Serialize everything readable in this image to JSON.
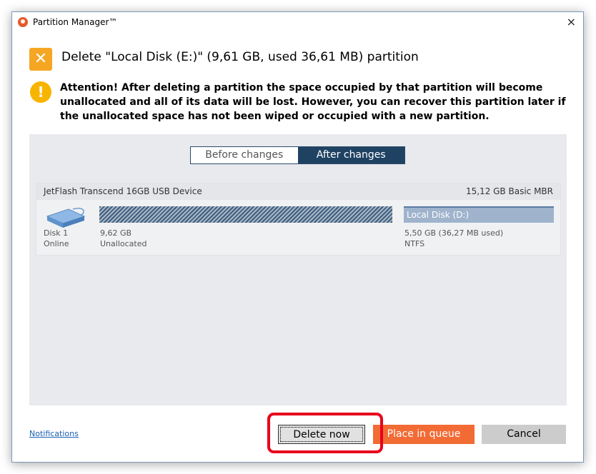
{
  "window": {
    "title": "Partition Manager™",
    "close_icon": "×"
  },
  "operation": {
    "badge_icon": "✕",
    "title": "Delete \"Local Disk (E:)\" (9,61 GB, used 36,61 MB) partition"
  },
  "warning": {
    "icon": "!",
    "text": "Attention! After deleting a partition the space occupied by that partition will become unallocated and all of its data will be lost. However, you can recover this partition later if the unallocated space has not been wiped or occupied with a new partition."
  },
  "preview": {
    "tabs": [
      {
        "label": "Before changes",
        "active": false
      },
      {
        "label": "After changes",
        "active": true
      }
    ],
    "disk": {
      "name": "JetFlash Transcend 16GB USB Device",
      "size_type": "15,12 GB Basic MBR",
      "label": "Disk 1",
      "status": "Online",
      "unallocated": {
        "size": "9,62 GB",
        "label": "Unallocated"
      },
      "partition": {
        "name": "Local Disk (D:)",
        "size": "5,50 GB (36,27 MB used)",
        "fs": "NTFS"
      }
    }
  },
  "footer": {
    "notifications_link": "Notifications",
    "delete_now": "Delete now",
    "place_in_queue": "Place in queue",
    "cancel": "Cancel"
  },
  "colors": {
    "accent_orange": "#f26b35",
    "badge_orange": "#f5a623",
    "warning_yellow": "#f7b500",
    "active_tab": "#1f4263",
    "partition_bar": "#9fb3cc",
    "highlight_red": "#e8001c"
  }
}
